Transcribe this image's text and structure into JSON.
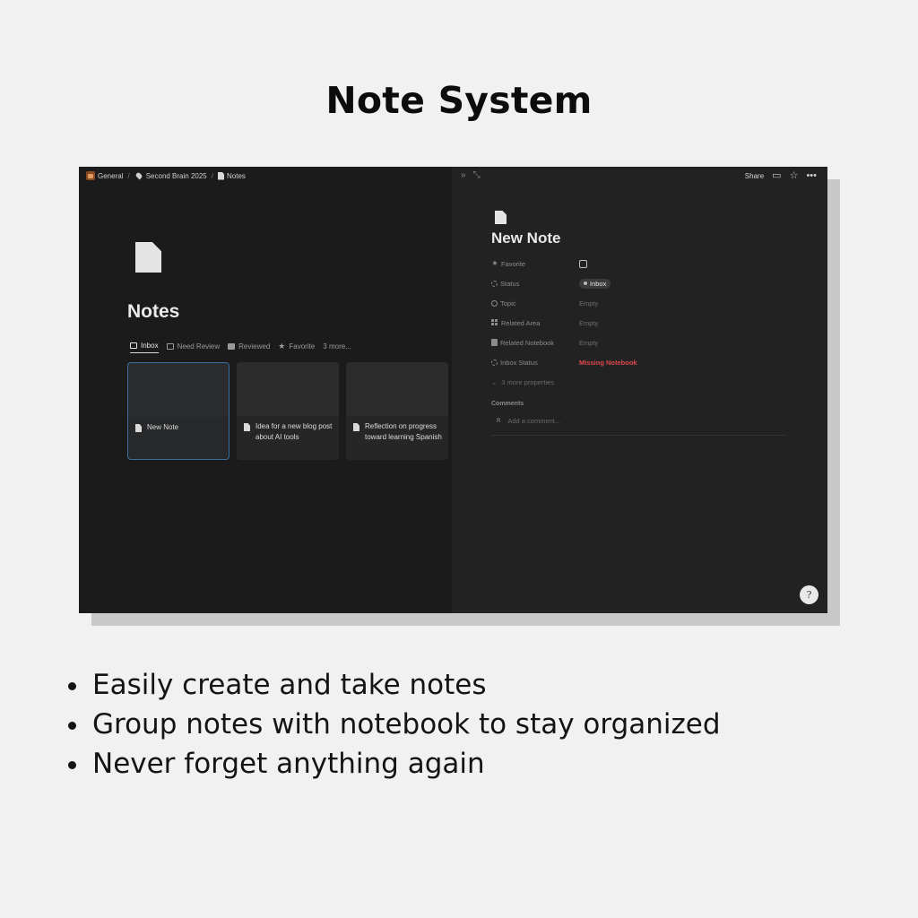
{
  "page": {
    "title": "Note System"
  },
  "breadcrumb": [
    {
      "label": "General",
      "icon": "workspace-home-icon"
    },
    {
      "label": "Second Brain 2025",
      "icon": "pin-icon"
    },
    {
      "label": "Notes",
      "icon": "document-icon"
    }
  ],
  "left_panel": {
    "title": "Notes",
    "tabs": [
      {
        "label": "Inbox",
        "icon": "inbox-icon",
        "active": true
      },
      {
        "label": "Need Review",
        "icon": "checkbox-icon",
        "active": false
      },
      {
        "label": "Reviewed",
        "icon": "checked-icon",
        "active": false
      },
      {
        "label": "Favorite",
        "icon": "star-icon",
        "active": false
      },
      {
        "label": "3 more...",
        "icon": "",
        "active": false
      }
    ],
    "cards": [
      {
        "label": "New Note",
        "selected": true
      },
      {
        "label": "Idea for a new blog post about AI tools",
        "selected": false
      },
      {
        "label": "Reflection on progress toward learning Spanish",
        "selected": false
      }
    ]
  },
  "right_panel": {
    "toolbar": {
      "share_label": "Share",
      "icons": [
        "expand-icon",
        "open-full-icon",
        "comment-icon",
        "star-icon",
        "more-icon"
      ]
    },
    "title": "New Note",
    "properties": [
      {
        "key": "Favorite",
        "type": "checkbox",
        "value": ""
      },
      {
        "key": "Status",
        "type": "status",
        "value": "Inbox"
      },
      {
        "key": "Topic",
        "type": "text",
        "value": "Empty"
      },
      {
        "key": "Related Area",
        "type": "text",
        "value": "Empty"
      },
      {
        "key": "Related Notebook",
        "type": "text",
        "value": "Empty"
      },
      {
        "key": "Inbox Status",
        "type": "alert",
        "value": "Missing Notebook"
      }
    ],
    "more_properties": "3 more properties",
    "comments": {
      "heading": "Comments",
      "avatar": "R",
      "placeholder": "Add a comment..."
    },
    "help_label": "?"
  },
  "features": [
    "Easily create and take notes",
    "Group notes with notebook to stay organized",
    "Never forget anything again"
  ],
  "colors": {
    "background": "#f1f1f1",
    "app_bg": "#1b1b1b",
    "accent_selected": "#3b6fa0",
    "alert": "#e0484d"
  }
}
